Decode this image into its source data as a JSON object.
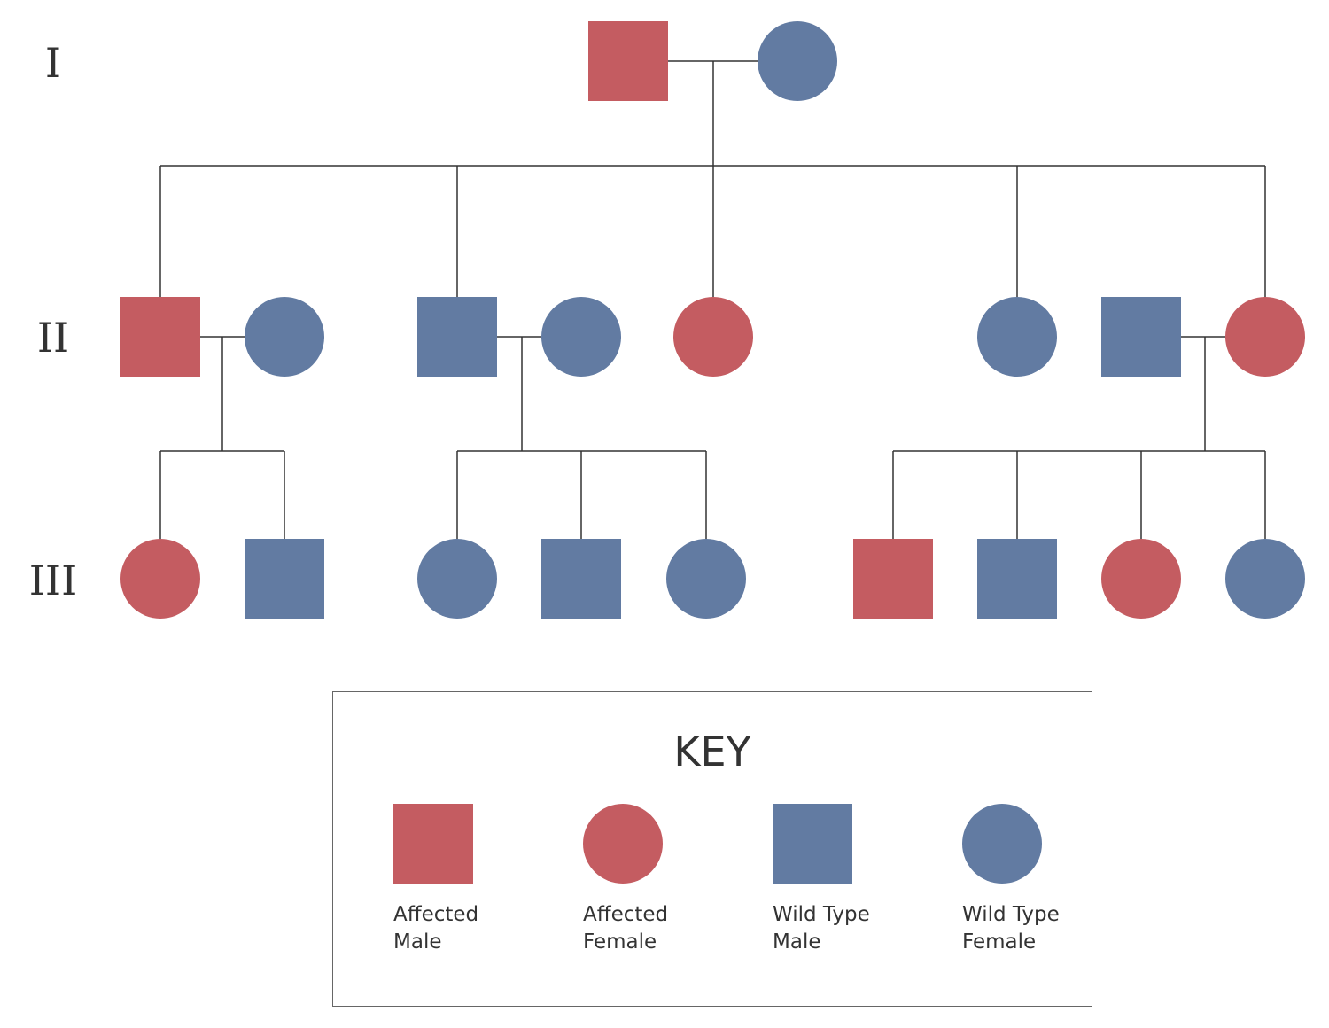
{
  "colors": {
    "affected": "#c45c61",
    "wild_type": "#627ba2",
    "line": "#333333"
  },
  "generations": [
    "I",
    "II",
    "III"
  ],
  "individuals": [
    {
      "id": "I-1",
      "gen": 0,
      "sex": "male",
      "status": "affected"
    },
    {
      "id": "I-2",
      "gen": 0,
      "sex": "female",
      "status": "wild_type"
    },
    {
      "id": "II-1",
      "gen": 1,
      "sex": "male",
      "status": "affected"
    },
    {
      "id": "II-2",
      "gen": 1,
      "sex": "female",
      "status": "wild_type"
    },
    {
      "id": "II-3",
      "gen": 1,
      "sex": "male",
      "status": "wild_type"
    },
    {
      "id": "II-4",
      "gen": 1,
      "sex": "female",
      "status": "wild_type"
    },
    {
      "id": "II-5",
      "gen": 1,
      "sex": "female",
      "status": "affected"
    },
    {
      "id": "II-6",
      "gen": 1,
      "sex": "female",
      "status": "wild_type"
    },
    {
      "id": "II-7",
      "gen": 1,
      "sex": "male",
      "status": "wild_type"
    },
    {
      "id": "II-8",
      "gen": 1,
      "sex": "female",
      "status": "affected"
    },
    {
      "id": "III-1",
      "gen": 2,
      "sex": "female",
      "status": "affected"
    },
    {
      "id": "III-2",
      "gen": 2,
      "sex": "male",
      "status": "wild_type"
    },
    {
      "id": "III-3",
      "gen": 2,
      "sex": "female",
      "status": "wild_type"
    },
    {
      "id": "III-4",
      "gen": 2,
      "sex": "male",
      "status": "wild_type"
    },
    {
      "id": "III-5",
      "gen": 2,
      "sex": "female",
      "status": "wild_type"
    },
    {
      "id": "III-6",
      "gen": 2,
      "sex": "male",
      "status": "affected"
    },
    {
      "id": "III-7",
      "gen": 2,
      "sex": "male",
      "status": "wild_type"
    },
    {
      "id": "III-8",
      "gen": 2,
      "sex": "female",
      "status": "affected"
    },
    {
      "id": "III-9",
      "gen": 2,
      "sex": "female",
      "status": "wild_type"
    }
  ],
  "couples": [
    {
      "partners": [
        "I-1",
        "I-2"
      ],
      "children": [
        "II-1",
        "II-3",
        "II-5",
        "II-6",
        "II-8"
      ]
    },
    {
      "partners": [
        "II-1",
        "II-2"
      ],
      "children": [
        "III-1",
        "III-2"
      ]
    },
    {
      "partners": [
        "II-3",
        "II-4"
      ],
      "children": [
        "III-3",
        "III-4",
        "III-5"
      ]
    },
    {
      "partners": [
        "II-7",
        "II-8"
      ],
      "children": [
        "III-6",
        "III-7",
        "III-8",
        "III-9"
      ]
    }
  ],
  "key": {
    "title": "KEY",
    "items": [
      {
        "label": "Affected\nMale",
        "sex": "male",
        "status": "affected"
      },
      {
        "label": "Affected\nFemale",
        "sex": "female",
        "status": "affected"
      },
      {
        "label": "Wild Type\nMale",
        "sex": "male",
        "status": "wild_type"
      },
      {
        "label": "Wild Type\nFemale",
        "sex": "female",
        "status": "wild_type"
      }
    ]
  }
}
